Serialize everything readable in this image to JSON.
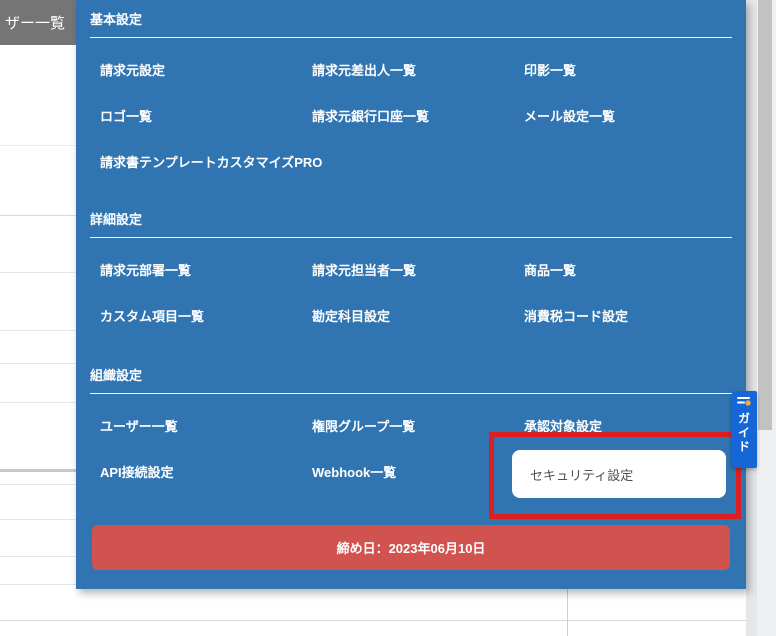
{
  "background": {
    "page_title_fragment": "ザー一覧"
  },
  "menu": {
    "sections": [
      {
        "title": "基本設定",
        "rows": [
          [
            "請求元設定",
            "請求元差出人一覧",
            "印影一覧"
          ],
          [
            "ロゴ一覧",
            "請求元銀行口座一覧",
            "メール設定一覧"
          ],
          [
            "請求書テンプレートカスタマイズPRO"
          ]
        ]
      },
      {
        "title": "詳細設定",
        "rows": [
          [
            "請求元部署一覧",
            "請求元担当者一覧",
            "商品一覧"
          ],
          [
            "カスタム項目一覧",
            "勘定科目設定",
            "消費税コード設定"
          ]
        ]
      },
      {
        "title": "組織設定",
        "rows": [
          [
            "ユーザー一覧",
            "権限グループ一覧",
            "承認対象設定"
          ],
          [
            "API接続設定",
            "Webhook一覧"
          ]
        ]
      }
    ],
    "closing_date_button": "締め日：2023年06月10日"
  },
  "highlight": {
    "label": "セキュリティ設定"
  },
  "guide_tab": {
    "label": "ガイド"
  },
  "colors": {
    "panel_blue": "#3075b2",
    "danger_red": "#d0534f",
    "highlight_red": "#de1f1f",
    "guide_blue": "#1567d8",
    "guide_dot_yellow": "#f6a83b",
    "topbar_gray": "#757575"
  }
}
